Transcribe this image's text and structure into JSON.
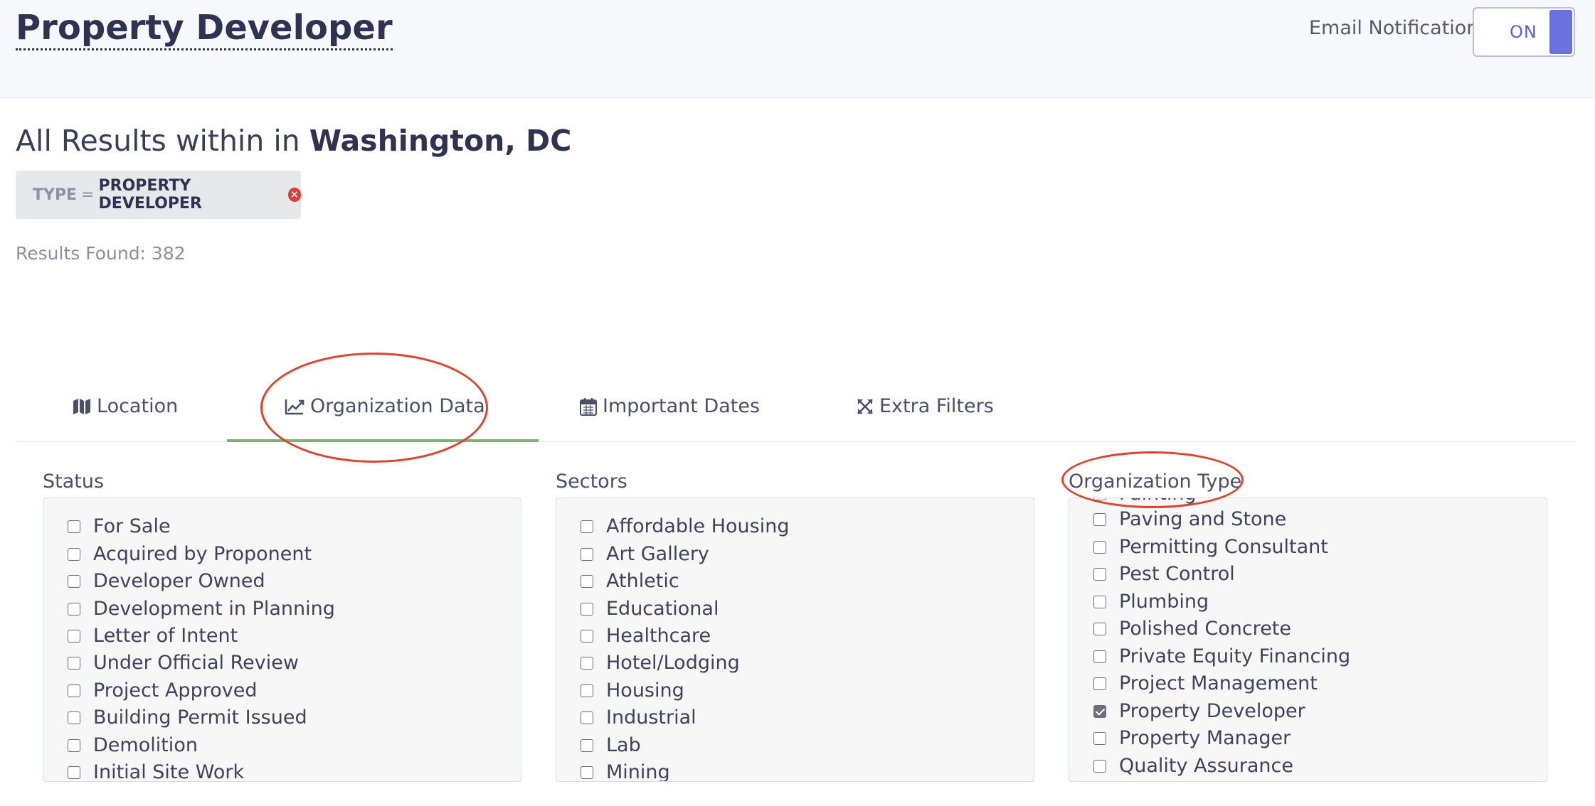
{
  "header": {
    "title": "Property Developer",
    "notifications_label": "Email Notifications",
    "toggle_state": "ON"
  },
  "results": {
    "prefix": "All Results within in ",
    "location": "Washington, DC",
    "filter_key": "TYPE",
    "filter_eq": "=",
    "filter_value": "PROPERTY DEVELOPER",
    "count_text": "Results Found: 382"
  },
  "tabs": [
    {
      "label": "Location",
      "icon": "map-icon"
    },
    {
      "label": "Organization Data",
      "icon": "chart-line-icon",
      "active": true
    },
    {
      "label": "Important Dates",
      "icon": "calendar-icon"
    },
    {
      "label": "Extra Filters",
      "icon": "expand-arrows-icon"
    }
  ],
  "panels": {
    "status": {
      "label": "Status",
      "items": [
        "For Sale",
        "Acquired by Proponent",
        "Developer Owned",
        "Development in Planning",
        "Letter of Intent",
        "Under Official Review",
        "Project Approved",
        "Building Permit Issued",
        "Demolition",
        "Initial Site Work"
      ]
    },
    "sectors": {
      "label": "Sectors",
      "items": [
        "Affordable Housing",
        "Art Gallery",
        "Athletic",
        "Educational",
        "Healthcare",
        "Hotel/Lodging",
        "Housing",
        "Industrial",
        "Lab",
        "Mining"
      ]
    },
    "org_type": {
      "label": "Organization Type",
      "items": [
        "Painting",
        "Paving and Stone",
        "Permitting Consultant",
        "Pest Control",
        "Plumbing",
        "Polished Concrete",
        "Private Equity Financing",
        "Project Management",
        "Property Developer",
        "Property Manager",
        "Quality Assurance"
      ],
      "checked": "Property Developer"
    }
  },
  "colors": {
    "accent": "#6b72e0",
    "active_tab": "#74b96a",
    "annotation": "#e1422a",
    "remove": "#e53935"
  }
}
